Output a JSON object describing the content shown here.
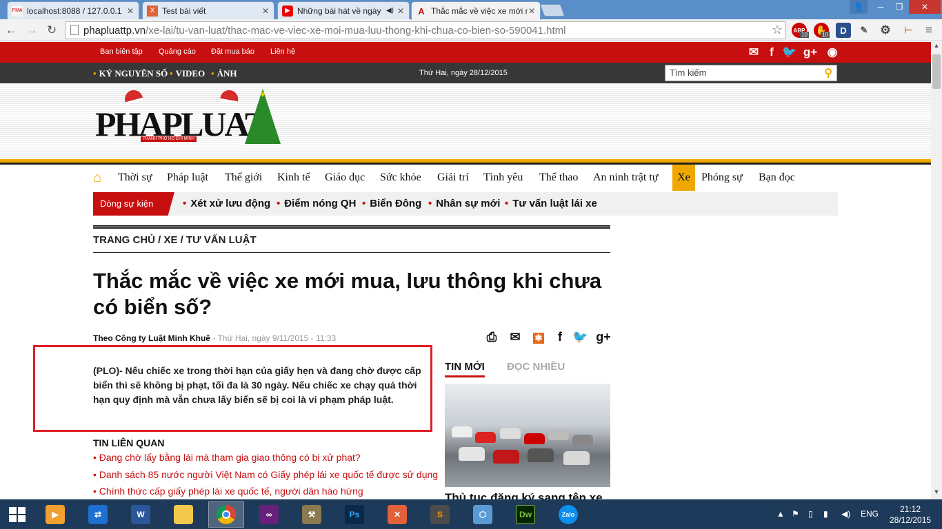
{
  "browser": {
    "tabs": [
      {
        "title": "localhost:8088 / 127.0.0.1",
        "icon": "PMA"
      },
      {
        "title": "Test bài viết",
        "icon": "X"
      },
      {
        "title": "Những bài hát về ngày",
        "icon": "▶"
      },
      {
        "title": "Thắc mắc về việc xe mới m",
        "icon": "A"
      }
    ],
    "url_domain": "phapluattp.vn",
    "url_path": "/xe-lai/tu-van-luat/thac-mac-ve-viec-xe-moi-mua-luu-thong-khi-chua-co-bien-so-590041.html",
    "ext_abp": "ABP",
    "ext_abp_count": "10",
    "ext_stop_count": "10",
    "ext_d": "D"
  },
  "site": {
    "top_links": [
      "Ban biên tập",
      "Quảng cáo",
      "Đặt mua báo",
      "Liên hệ"
    ],
    "social": [
      "✉",
      "f",
      "t",
      "g+",
      "rss"
    ],
    "dark_links": [
      "KỶ NGUYÊN SỐ",
      "VIDEO",
      "ẢNH"
    ],
    "date": "Thứ Hai, ngày 28/12/2015",
    "search_placeholder": "Tìm kiếm",
    "logo": "PHAPLUAT",
    "logo_sub": "THÀNH PHỐ HỒ CHÍ MINH",
    "nav": [
      "Thời sự",
      "Pháp luật",
      "Thế giới",
      "Kinh tế",
      "Giáo dục",
      "Sức khỏe",
      "Giải trí",
      "Tình yêu",
      "Thể thao",
      "An ninh trật tự",
      "Xe",
      "Phóng sự",
      "Bạn đọc"
    ],
    "nav_active": "Xe",
    "events_label": "Dòng sự kiện",
    "events": [
      "Xét xử lưu động",
      "Điểm nóng QH",
      "Biển Đông",
      "Nhân sự mới",
      "Tư vấn luật lái xe"
    ]
  },
  "article": {
    "breadcrumb": "TRANG CHỦ / XE / TƯ VẤN LUẬT",
    "title": "Thắc mắc về việc xe mới mua, lưu thông khi chưa có biển số?",
    "author": "Theo Công ty Luật Minh Khuê",
    "meta": "- Thứ Hai, ngày 9/11/2015 - 11:33",
    "lead": "(PLO)- Nếu chiếc xe trong thời hạn của giấy hẹn và đang chờ được cấp biển thì sẽ không bị phạt, tối đa là 30 ngày. Nếu chiếc xe chạy quá thời hạn quy định mà vẫn chưa lấy biển sẽ bị coi là vi phạm pháp luật.",
    "related_heading": "TIN LIÊN QUAN",
    "related": [
      "Đang chờ lấy bằng lái mà tham gia giao thông có bị xử phạt?",
      "Danh sách 85 nước người Việt Nam có Giấy phép lái xe quốc tế được sử dụng",
      "Chính thức cấp giấy phép lái xe quốc tế, người dân hào hứng"
    ]
  },
  "sidebar": {
    "tab_new": "TIN MỚI",
    "tab_popular": "ĐỌC NHIỀU",
    "caption": "Thủ tục đăng ký sang tên xe"
  },
  "taskbar": {
    "apps": [
      "W",
      "Ps",
      "Dw",
      "Zalo"
    ],
    "lang": "ENG",
    "time": "21:12",
    "date": "28/12/2015"
  },
  "colors": {
    "brand_red": "#c80f0f",
    "accent_yellow": "#f0a800",
    "highlight_box": "#e01e26"
  }
}
